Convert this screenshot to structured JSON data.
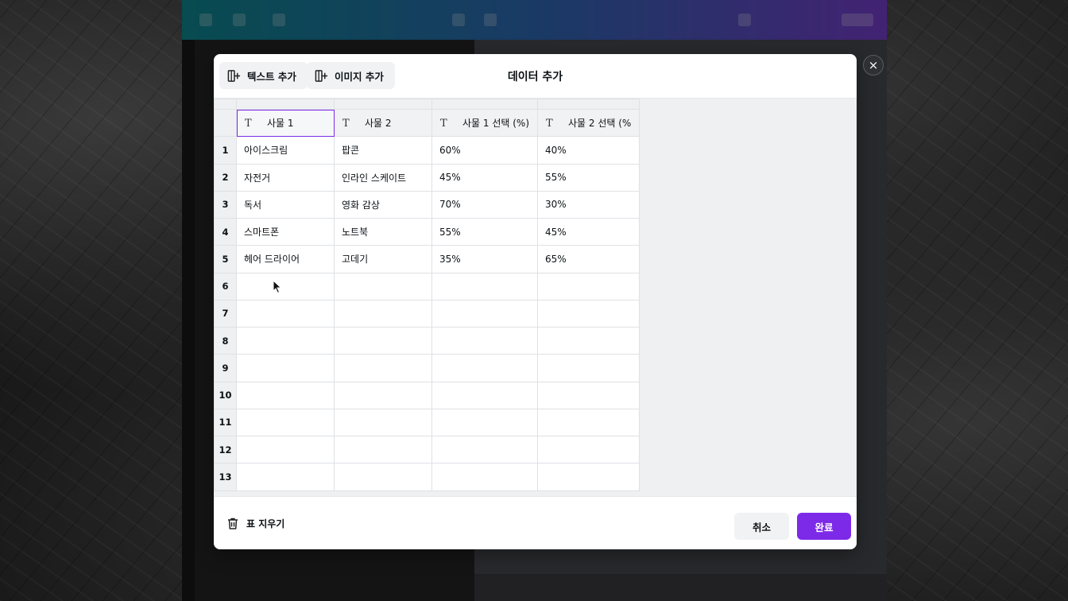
{
  "modal": {
    "title": "데이터 추가",
    "add_text_label": "텍스트 추가",
    "add_image_label": "이미지 추가",
    "clear_table_label": "표 지우기",
    "cancel_label": "취소",
    "done_label": "완료",
    "close_icon": "×"
  },
  "table": {
    "columns": [
      "사물 1",
      "사물 2",
      "사물 1 선택 (%)",
      "사물 2 선택 (%"
    ],
    "active_column": 0,
    "row_numbers": [
      "1",
      "2",
      "3",
      "4",
      "5",
      "6",
      "7",
      "8",
      "9",
      "10",
      "11",
      "12",
      "13"
    ],
    "rows": [
      [
        "아이스크림",
        "팝콘",
        "60%",
        "40%"
      ],
      [
        "자전거",
        "인라인 스케이트",
        "45%",
        "55%"
      ],
      [
        "독서",
        "영화 감상",
        "70%",
        "30%"
      ],
      [
        "스마트폰",
        "노트북",
        "55%",
        "45%"
      ],
      [
        "헤어 드라이어",
        "고데기",
        "35%",
        "65%"
      ],
      [
        "",
        "",
        "",
        ""
      ],
      [
        "",
        "",
        "",
        ""
      ],
      [
        "",
        "",
        "",
        ""
      ],
      [
        "",
        "",
        "",
        ""
      ],
      [
        "",
        "",
        "",
        ""
      ],
      [
        "",
        "",
        "",
        ""
      ],
      [
        "",
        "",
        "",
        ""
      ],
      [
        "",
        "",
        "",
        ""
      ]
    ]
  },
  "colors": {
    "accent": "#7d2ae8",
    "header_bg": "#f1f2f4"
  }
}
